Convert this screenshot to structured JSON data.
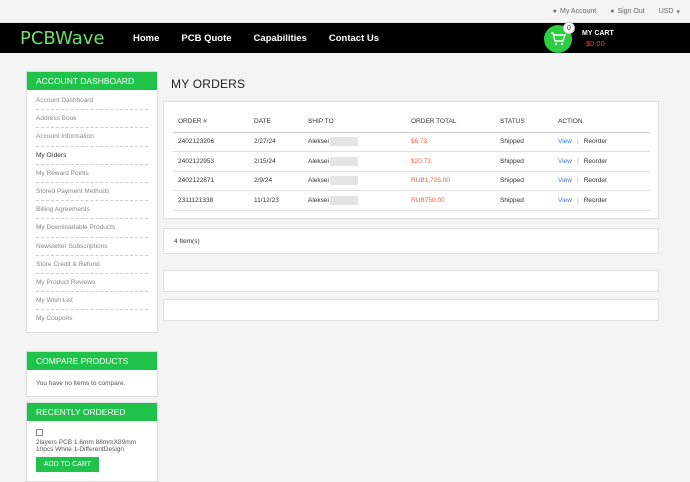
{
  "topbar": {
    "my_account": "My Account",
    "sign_out": "Sign Out",
    "currency": "USD"
  },
  "brand": {
    "logo_text": "PCBWave"
  },
  "nav": {
    "items": [
      "Home",
      "PCB Quote",
      "Capabilities",
      "Contact Us"
    ]
  },
  "cart": {
    "count": "0",
    "label": "MY CART",
    "total": "$0.00"
  },
  "sidebar": {
    "title": "ACCOUNT DASHBOARD",
    "items": [
      "Account Dashboard",
      "Address Book",
      "Account Information",
      "My Orders",
      "My Reward Points",
      "Stored Payment Methods",
      "Billing Agreements",
      "My Downloadable Products",
      "Newsletter Subscriptions",
      "Store Credit & Refund",
      "My Product Reviews",
      "My Wish List",
      "My Coupons"
    ],
    "active_index": 3
  },
  "compare": {
    "title": "COMPARE PRODUCTS",
    "text": "You have no items to compare."
  },
  "recent": {
    "title": "RECENTLY ORDERED",
    "item": "2layers PCB 1.6mm 88mmX89mm 10pcs White 1-DifferentDesign",
    "button": "ADD TO CART"
  },
  "main": {
    "title": "MY ORDERS",
    "columns": [
      "ORDER #",
      "DATE",
      "SHIP TO",
      "ORDER TOTAL",
      "STATUS",
      "ACTION"
    ],
    "rows": [
      {
        "order": "2402123206",
        "date": "2/27/24",
        "ship_to": "Aleksei",
        "total": "$6.73",
        "status": "Shipped",
        "view": "View",
        "reorder": "Reorder"
      },
      {
        "order": "2402122953",
        "date": "2/15/24",
        "ship_to": "Aleksei",
        "total": "$20.73",
        "status": "Shipped",
        "view": "View",
        "reorder": "Reorder"
      },
      {
        "order": "2402122871",
        "date": "2/9/24",
        "ship_to": "Aleksei",
        "total": "RUB1,725.00",
        "status": "Shipped",
        "view": "View",
        "reorder": "Reorder"
      },
      {
        "order": "2311121338",
        "date": "11/12/23",
        "ship_to": "Aleksei",
        "total": "RUB750.00",
        "status": "Shipped",
        "view": "View",
        "reorder": "Reorder"
      }
    ],
    "item_count": "4 Item(s)"
  },
  "colors": {
    "accent": "#1fc24a",
    "price": "#ff5a36",
    "link": "#3a7ad6",
    "nav_bg": "#000000"
  }
}
